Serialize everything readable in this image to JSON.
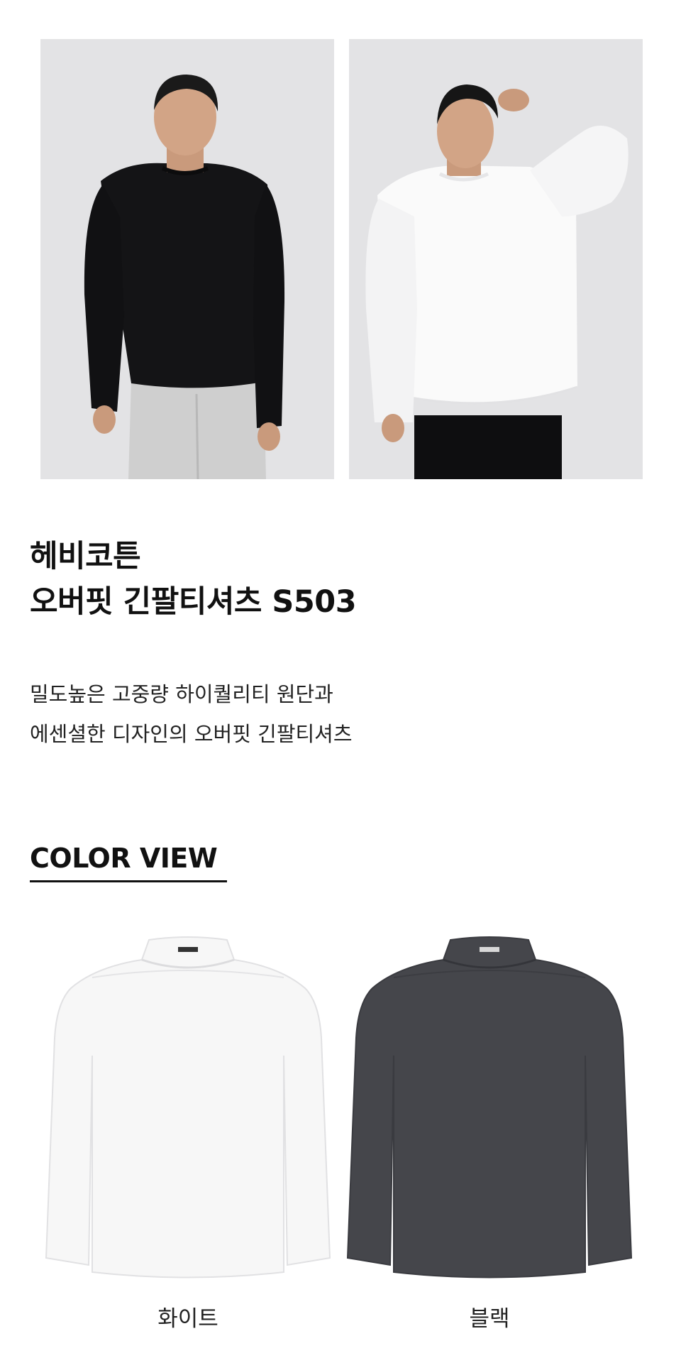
{
  "product": {
    "title_line1": "헤비코튼",
    "title_line2": "오버핏 긴팔티셔츠 S503",
    "desc_line1": "밀도높은 고중량 하이퀄리티 원단과",
    "desc_line2": "에센셜한 디자인의 오버핏 긴팔티셔츠"
  },
  "color_view": {
    "heading": "COLOR VIEW",
    "colors": [
      {
        "label": "화이트",
        "hex": "#f7f7f7"
      },
      {
        "label": "블랙",
        "hex": "#45464b"
      }
    ]
  },
  "photos": [
    {
      "name": "model-black-shirt",
      "shirt_color": "#141416",
      "pants_color": "#cfcfcf"
    },
    {
      "name": "model-white-shirt",
      "shirt_color": "#fafafa",
      "pants_color": "#0e0e10"
    }
  ]
}
